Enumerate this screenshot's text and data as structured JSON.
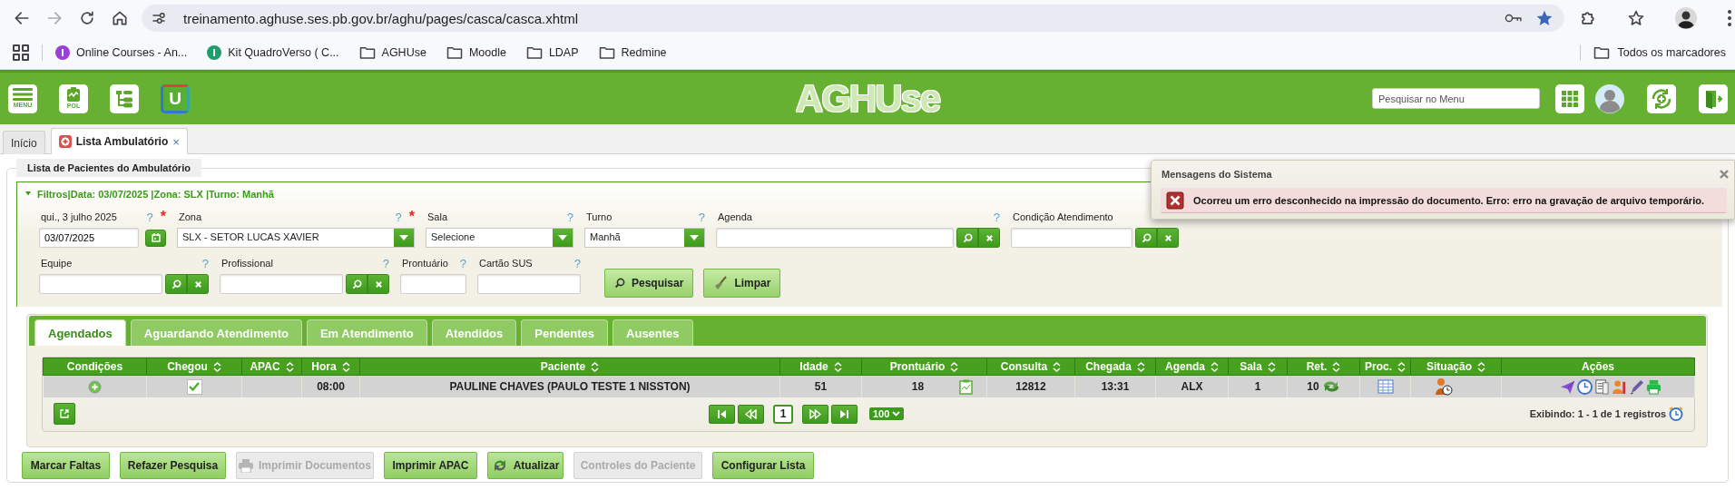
{
  "browser": {
    "url": "treinamento.aghuse.ses.pb.gov.br/aghu/pages/casca/casca.xhtml",
    "bookmarks": [
      {
        "label": "Online Courses - An...",
        "kind": "site",
        "color": "#9b3fd6"
      },
      {
        "label": "Kit QuadroVerso ( C...",
        "kind": "site",
        "color": "#1f9d6a"
      },
      {
        "label": "AGHUse",
        "kind": "folder"
      },
      {
        "label": "Moodle",
        "kind": "folder"
      },
      {
        "label": "LDAP",
        "kind": "folder"
      },
      {
        "label": "Redmine",
        "kind": "folder"
      }
    ],
    "all_bookmarks": "Todos os marcadores"
  },
  "app": {
    "tools": [
      {
        "kind": "menu",
        "label": "MENU"
      },
      {
        "kind": "pol",
        "label": "POL"
      },
      {
        "kind": "tree"
      },
      {
        "kind": "u",
        "label": "U"
      }
    ],
    "logo": "AGHUse",
    "search": {
      "placeholder": "Pesquisar no Menu"
    }
  },
  "doc_tabs": [
    {
      "label": "Início",
      "selected": false
    },
    {
      "label": "Lista Ambulatório",
      "selected": true,
      "close": "×"
    }
  ],
  "panel_title": "Lista de Pacientes do Ambulatório",
  "filters": {
    "expanded": true,
    "summary": "Filtros|Data: 03/07/2025 |Zona: SLX |Turno: Manhã",
    "fields": [
      {
        "kind": "date",
        "label": "qui., 3 julho 2025",
        "help": "?",
        "required": "*",
        "value": "03/07/2025"
      },
      {
        "kind": "select",
        "label": "Zona",
        "help": "?",
        "required": "*",
        "value": "SLX - SETOR LUCAS XAVIER"
      },
      {
        "kind": "select",
        "label": "Sala",
        "help": "?",
        "value": "Selecione"
      },
      {
        "kind": "select",
        "label": "Turno",
        "help": "?",
        "value": "Manhã"
      },
      {
        "kind": "lookup",
        "label": "Agenda",
        "help": "?"
      },
      {
        "kind": "lookup",
        "label": "Condição Atendimento"
      },
      {
        "kind": "lookup",
        "label": "Equipe",
        "help": "?"
      },
      {
        "kind": "lookup",
        "label": "Profissional",
        "help": "?"
      },
      {
        "kind": "text",
        "label": "Prontuário",
        "help": "?"
      },
      {
        "kind": "text",
        "label": "Cartão SUS",
        "help": "?"
      }
    ],
    "buttons": [
      {
        "kind": "search",
        "label": "Pesquisar"
      },
      {
        "kind": "clear",
        "label": "Limpar"
      }
    ]
  },
  "list_tabs": [
    {
      "label": "Agendados",
      "selected": true
    },
    {
      "label": "Aguardando Atendimento",
      "selected": false
    },
    {
      "label": "Em Atendimento",
      "selected": false
    },
    {
      "label": "Atendidos",
      "selected": false
    },
    {
      "label": "Pendentes",
      "selected": false
    },
    {
      "label": "Ausentes",
      "selected": false
    }
  ],
  "table": {
    "columns": [
      {
        "label": "Condições",
        "sortable": false
      },
      {
        "label": "Chegou",
        "sortable": true
      },
      {
        "label": "APAC",
        "sortable": true
      },
      {
        "label": "Hora",
        "sortable": true
      },
      {
        "label": "Paciente",
        "sortable": true
      },
      {
        "label": "Idade",
        "sortable": true
      },
      {
        "label": "Prontuário",
        "sortable": true
      },
      {
        "label": "Consulta",
        "sortable": true
      },
      {
        "label": "Chegada",
        "sortable": true
      },
      {
        "label": "Agenda",
        "sortable": true
      },
      {
        "label": "Sala",
        "sortable": true
      },
      {
        "label": "Ret.",
        "sortable": true
      },
      {
        "label": "Proc.",
        "sortable": true
      },
      {
        "label": "Situação",
        "sortable": true
      },
      {
        "label": "Ações",
        "sortable": false
      }
    ],
    "rows": [
      {
        "arrived": true,
        "hora": "08:00",
        "paciente": "PAULINE CHAVES (PAULO TESTE 1 NISSTON)",
        "idade": "51",
        "prontuario": "18",
        "consulta": "12812",
        "chegada": "13:31",
        "agenda": "ALX",
        "sala": "1",
        "ret": "10"
      }
    ]
  },
  "pager": {
    "pages": [
      {
        "label": "1",
        "selected": true
      }
    ],
    "page_size": "100",
    "summary": "Exibindo: 1 - 1 de 1 registros"
  },
  "actions": [
    {
      "label": "Marcar Faltas",
      "disabled": false
    },
    {
      "label": "Refazer Pesquisa",
      "disabled": false
    },
    {
      "label": "Imprimir Documentos",
      "disabled": true,
      "kind": "printer"
    },
    {
      "label": "Imprimir APAC",
      "disabled": false
    },
    {
      "label": "Atualizar",
      "disabled": false,
      "kind": "refresh"
    },
    {
      "label": "Controles do Paciente",
      "disabled": true
    },
    {
      "label": "Configurar Lista",
      "disabled": false
    }
  ],
  "toast": {
    "title": "Mensagens do Sistema",
    "message": "Ocorreu um erro desconhecido na impressão do documento. Erro: erro na gravação de arquivo temporário."
  }
}
